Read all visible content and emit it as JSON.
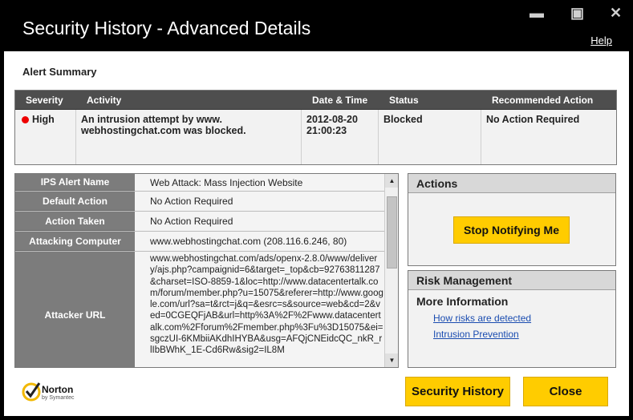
{
  "window": {
    "title": "Security History - Advanced Details",
    "help": "Help",
    "minimize_glyph": "▬",
    "maximize_glyph": "▣",
    "close_glyph": "✕"
  },
  "alert_summary": {
    "title": "Alert Summary",
    "headers": {
      "severity": "Severity",
      "activity": "Activity",
      "datetime": "Date & Time",
      "status": "Status",
      "recommended": "Recommended Action"
    },
    "row": {
      "severity": "High",
      "activity_line1": "An intrusion attempt by www.",
      "activity_line2": "webhostingchat.com was blocked.",
      "date": "2012-08-20",
      "time": "21:00:23",
      "status": "Blocked",
      "recommended": "No Action Required"
    }
  },
  "details": {
    "rows": [
      {
        "label": "IPS Alert Name",
        "value": "Web Attack: Mass Injection Website"
      },
      {
        "label": "Default Action",
        "value": "No Action Required"
      },
      {
        "label": "Action Taken",
        "value": "No Action Required"
      },
      {
        "label": "Attacking Computer",
        "value": "www.webhostingchat.com (208.116.6.246, 80)"
      },
      {
        "label": "Attacker URL",
        "value": "www.webhostingchat.com/ads/openx-2.8.0/www/delivery/ajs.php?campaignid=6&target=_top&cb=92763811287&charset=ISO-8859-1&loc=http://www.datacentertalk.com/forum/member.php?u=15075&referer=http://www.google.com/url?sa=t&rct=j&q=&esrc=s&source=web&cd=2&ved=0CGEQFjAB&url=http%3A%2F%2Fwww.datacentertalk.com%2Fforum%2Fmember.php%3Fu%3D15075&ei=sgczUI-6KMbiiAKdhIHYBA&usg=AFQjCNEidcQC_nkR_rlIbBWhK_1E-Cd6Rw&sig2=IL8M"
      }
    ]
  },
  "actions": {
    "title": "Actions",
    "stop_button": "Stop Notifying Me"
  },
  "risk": {
    "title": "Risk Management",
    "more_info": "More Information",
    "link1": "How risks are detected",
    "link2": "Intrusion Prevention"
  },
  "footer": {
    "brand": "Norton",
    "brand_sub": "by Symantec",
    "security_history_button": "Security History",
    "close_button": "Close"
  },
  "colors": {
    "accent_yellow": "#ffcc00",
    "severity_high": "#e00000",
    "header_dark": "#4e4e4e"
  }
}
